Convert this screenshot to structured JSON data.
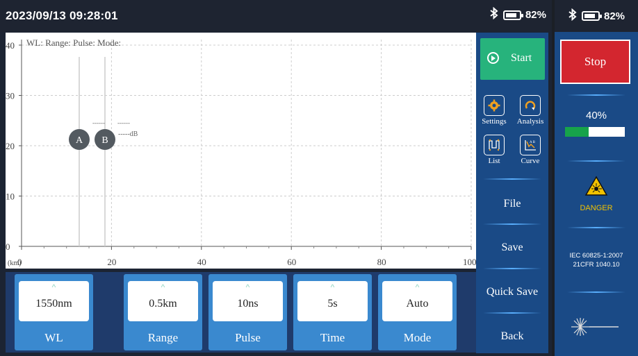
{
  "status_bar": {
    "datetime": "2023/09/13 09:28:01",
    "battery": "82%",
    "battery_level": 0.82
  },
  "plot": {
    "info": "WL:  Range:  Pulse:  Mode:",
    "y_ticks": [
      "40",
      "30",
      "20",
      "10",
      "0"
    ],
    "x_ticks": [
      "0",
      "20",
      "40",
      "60",
      "80",
      "100"
    ],
    "x_unit": "(km)",
    "marker_a": "A",
    "marker_b": "B",
    "dash_a": "------",
    "dash_b": "------",
    "db_label": "-----dB"
  },
  "params": [
    {
      "value": "1550nm",
      "label": "WL"
    },
    {
      "value": "0.5km",
      "label": "Range"
    },
    {
      "value": "10ns",
      "label": "Pulse"
    },
    {
      "value": "5s",
      "label": "Time"
    },
    {
      "value": "Auto",
      "label": "Mode"
    }
  ],
  "side": {
    "start": "Start",
    "settings": "Settings",
    "analysis": "Analysis",
    "list": "List",
    "curve": "Curve",
    "file": "File",
    "save": "Save",
    "quick_save": "Quick Save",
    "back": "Back"
  },
  "right_panel": {
    "battery": "82%",
    "stop": "Stop",
    "progress_text": "40%",
    "progress": 0.4,
    "danger": "DANGER",
    "iec_line1": "IEC 60825-1:2007",
    "iec_line2": "21CFR 1040.10"
  },
  "colors": {
    "accent_green": "#27b37c",
    "stop_red": "#d3262f",
    "panel_blue": "#1a4a86",
    "card_blue": "#3a89cf",
    "danger_yellow": "#f2c200"
  }
}
